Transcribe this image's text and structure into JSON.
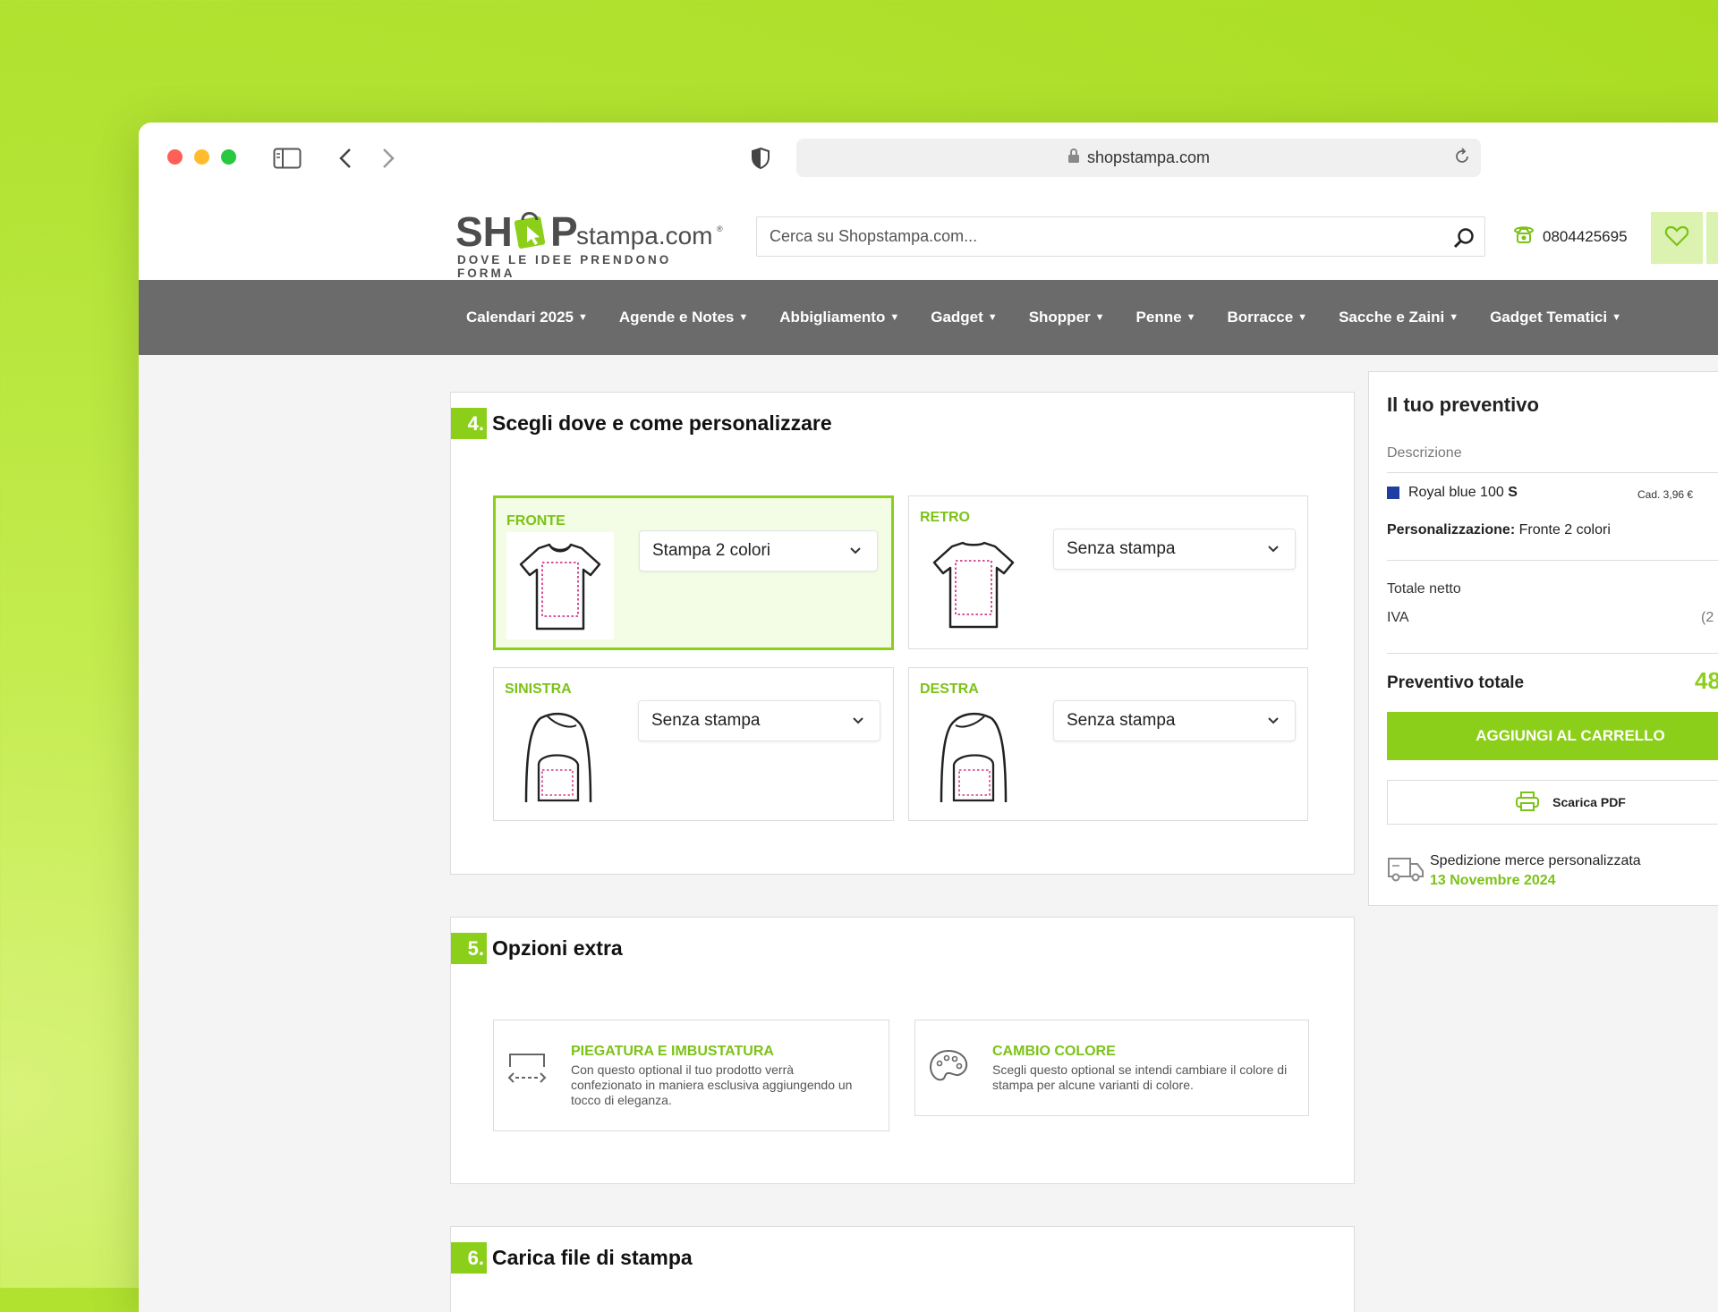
{
  "browser": {
    "url": "shopstampa.com"
  },
  "header": {
    "logo_main": "SH Pstampa.com",
    "logo_com": "",
    "logo_tagline": "DOVE LE IDEE PRENDONO FORMA",
    "search_placeholder": "Cerca su Shopstampa.com...",
    "phone": "0804425695"
  },
  "nav": {
    "items": [
      "Calendari 2025",
      "Agende e Notes",
      "Abbigliamento",
      "Gadget",
      "Shopper",
      "Penne",
      "Borracce",
      "Sacche e Zaini",
      "Gadget Tematici"
    ]
  },
  "step4": {
    "num": "4.",
    "title": "Scegli dove e come personalizzare",
    "placements": [
      {
        "label": "FRONTE",
        "value": "Stampa 2 colori",
        "active": true
      },
      {
        "label": "RETRO",
        "value": "Senza stampa",
        "active": false
      },
      {
        "label": "SINISTRA",
        "value": "Senza stampa",
        "active": false
      },
      {
        "label": "DESTRA",
        "value": "Senza stampa",
        "active": false
      }
    ]
  },
  "step5": {
    "num": "5.",
    "title": "Opzioni extra",
    "options": [
      {
        "title": "PIEGATURA E IMBUSTATURA",
        "text": "Con questo optional il tuo prodotto verrà confezionato in maniera esclusiva aggiungendo un tocco di eleganza."
      },
      {
        "title": "CAMBIO COLORE",
        "text": "Scegli questo optional se intendi cambiare il colore di stampa per alcune varianti di colore."
      }
    ]
  },
  "step6": {
    "num": "6.",
    "title": "Carica file di stampa"
  },
  "quote": {
    "title": "Il tuo preventivo",
    "desc_header": "Descrizione",
    "item_name": "Royal blue 100",
    "item_size": "S",
    "item_unit": "Cad. 3,96 €",
    "pers_label": "Personalizzazione:",
    "pers_value": "Fronte 2 colori",
    "net_label": "Totale netto",
    "iva_label": "IVA",
    "iva_pct": "(2",
    "total_label": "Preventivo totale",
    "total_value": "48",
    "add_cart": "AGGIUNGI AL CARRELLO",
    "pdf": "Scarica PDF",
    "ship_label": "Spedizione merce personalizzata",
    "ship_date": "13 Novembre 2024",
    "swatch_color": "#1f3fa0"
  },
  "colors": {
    "accent": "#8ccf1a",
    "nav_bg": "#6b6b6b",
    "page_bg": "#b3e334"
  }
}
